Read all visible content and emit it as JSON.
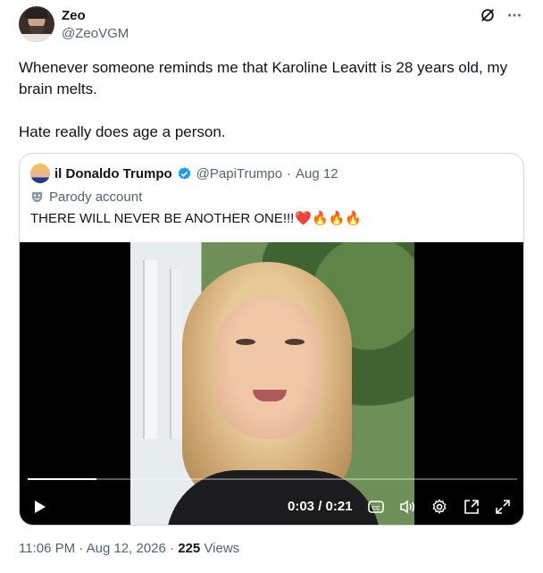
{
  "author": {
    "name": "Zeo",
    "handle": "@ZeoVGM"
  },
  "tweet": {
    "line1": "Whenever someone reminds me that Karoline Leavitt is 28 years old, my brain melts.",
    "line2": "Hate really does age a person."
  },
  "quote": {
    "name": "il Donaldo Trumpo",
    "handle": "@PapiTrumpo",
    "separator": "·",
    "date": "Aug 12",
    "parody_label": "Parody account",
    "text": "THERE WILL NEVER BE ANOTHER ONE!!!",
    "emojis": "❤️🔥🔥🔥"
  },
  "video": {
    "current_time": "0:03",
    "duration": "0:21",
    "time_display": "0:03 / 0:21",
    "progress_fraction": 0.14
  },
  "meta": {
    "time": "11:06 PM",
    "separator": "·",
    "date": "Aug 12, 2026",
    "views_count": "225",
    "views_label": "Views"
  },
  "colors": {
    "text": "#0f1419",
    "secondary": "#536471",
    "border": "#cfd9de",
    "verified": "#1d9bf0"
  },
  "icons": [
    "grok-icon",
    "more-icon",
    "verified-badge-icon",
    "parody-mask-icon",
    "play-icon",
    "captions-icon",
    "volume-icon",
    "settings-icon",
    "picture-in-picture-icon",
    "fullscreen-icon"
  ]
}
